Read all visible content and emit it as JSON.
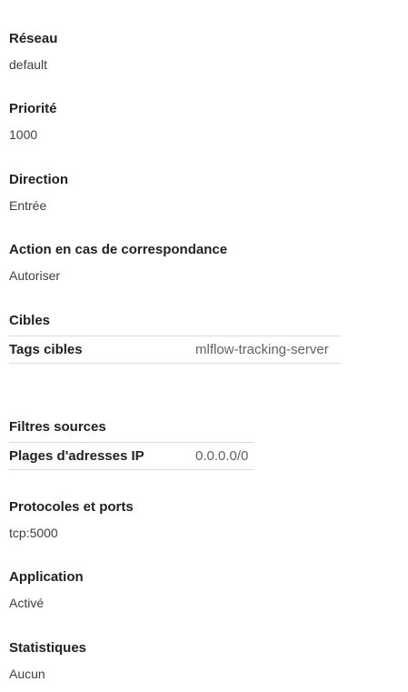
{
  "network": {
    "label": "Réseau",
    "value": "default"
  },
  "priority": {
    "label": "Priorité",
    "value": "1000"
  },
  "direction": {
    "label": "Direction",
    "value": "Entrée"
  },
  "action": {
    "label": "Action en cas de correspondance",
    "value": "Autoriser"
  },
  "targets": {
    "label": "Cibles",
    "rows": [
      {
        "key": "Tags cibles",
        "value": "mlflow-tracking-server"
      }
    ]
  },
  "source_filters": {
    "label": "Filtres sources",
    "rows": [
      {
        "key": "Plages d'adresses IP",
        "value": "0.0.0.0/0"
      }
    ]
  },
  "protocols": {
    "label": "Protocoles et ports",
    "value": "tcp:5000"
  },
  "application": {
    "label": "Application",
    "value": "Activé"
  },
  "statistics": {
    "label": "Statistiques",
    "value": "Aucun"
  }
}
